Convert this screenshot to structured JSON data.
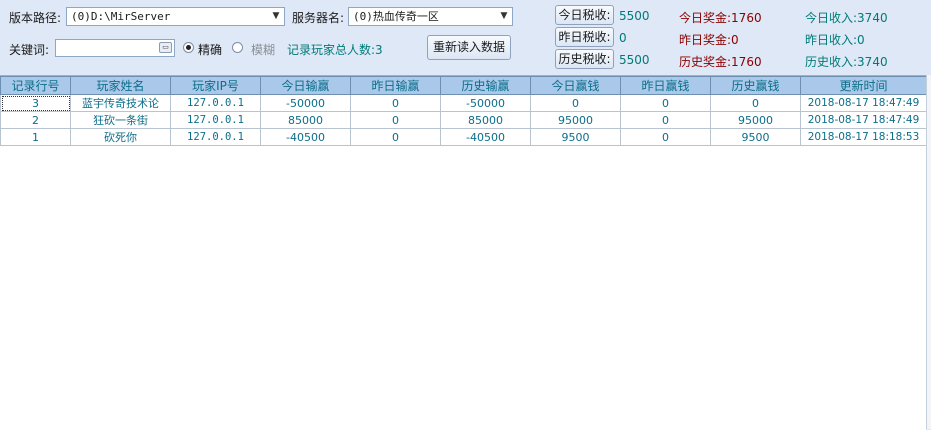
{
  "toolbar": {
    "version_path_label": "版本路径:",
    "version_path_value": "(0)D:\\MirServer",
    "server_name_label": "服务器名:",
    "server_name_value": "(0)热血传奇一区",
    "keyword_label": "关键词:",
    "keyword_value": "",
    "match_exact_label": "精确",
    "match_fuzzy_label": "模糊",
    "match_selected": "exact",
    "total_players_text": "记录玩家总人数:3",
    "reload_button_label": "重新读入数据"
  },
  "stats": {
    "today_tax_button": "今日税收:",
    "today_tax_value": "5500",
    "yesterday_tax_button": "昨日税收:",
    "yesterday_tax_value": "0",
    "history_tax_button": "历史税收:",
    "history_tax_value": "5500",
    "today_bonus": "今日奖金:1760",
    "yesterday_bonus": "昨日奖金:0",
    "history_bonus": "历史奖金:1760",
    "today_income": "今日收入:3740",
    "yesterday_income": "昨日收入:0",
    "history_income": "历史收入:3740"
  },
  "colors": {
    "teal_text": "#007a78",
    "bonus_text": "#8b0000",
    "header_bg": "#a9c8ea",
    "background": "#dfe8f6"
  },
  "table": {
    "columns": [
      "记录行号",
      "玩家姓名",
      "玩家IP号",
      "今日输赢",
      "昨日输赢",
      "历史输赢",
      "今日赢钱",
      "昨日赢钱",
      "历史赢钱",
      "更新时间"
    ],
    "rows": [
      [
        "3",
        "蓝宇传奇技术论",
        "127.0.0.1",
        "-50000",
        "0",
        "-50000",
        "0",
        "0",
        "0",
        "2018-08-17 18:47:49"
      ],
      [
        "2",
        "狂砍一条街",
        "127.0.0.1",
        "85000",
        "0",
        "85000",
        "95000",
        "0",
        "95000",
        "2018-08-17 18:47:49"
      ],
      [
        "1",
        "砍死你",
        "127.0.0.1",
        "-40500",
        "0",
        "-40500",
        "9500",
        "0",
        "9500",
        "2018-08-17 18:18:53"
      ]
    ]
  }
}
